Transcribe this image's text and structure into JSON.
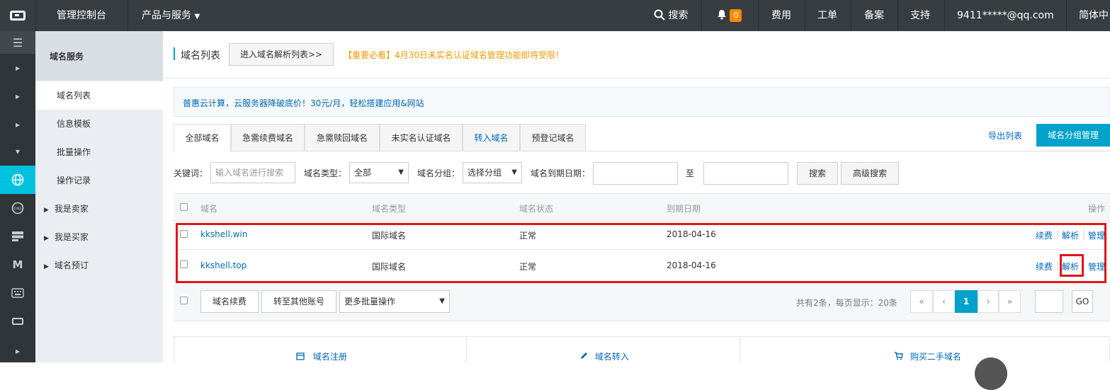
{
  "topbar": {
    "console": "管理控制台",
    "products": "产品与服务",
    "search": "搜索",
    "notifications": "0",
    "fees": "费用",
    "tickets": "工单",
    "icp": "备案",
    "support": "支持",
    "account": "9411*****@qq.com",
    "language": "简体中"
  },
  "sidebar": {
    "title": "域名服务",
    "items": [
      "域名列表",
      "信息模板",
      "批量操作",
      "操作记录",
      "我是卖家",
      "我是买家",
      "域名预订"
    ]
  },
  "header": {
    "title": "域名列表",
    "dns_button": "进入域名解析列表>>",
    "notice": "【重要必看】4月30日未实名认证域名管理功能即将受限！"
  },
  "promo": "普惠云计算，云服务器降破底价！30元/月，轻松搭建应用&网站",
  "tabs": [
    "全部域名",
    "急需续费域名",
    "急需赎回域名",
    "未实名认证域名",
    "转入域名",
    "预登记域名"
  ],
  "actions": {
    "export": "导出列表",
    "group_manage": "域名分组管理"
  },
  "filters": {
    "keyword_label": "关键词：",
    "keyword_placeholder": "输入域名进行搜索",
    "type_label": "域名类型：",
    "type_value": "全部",
    "group_label": "域名分组：",
    "group_value": "选择分组",
    "expire_label": "域名到期日期：",
    "to": "至",
    "search": "搜索",
    "advanced": "高级搜索"
  },
  "table": {
    "headers": [
      "域名",
      "域名类型",
      "域名状态",
      "到期日期",
      "操作"
    ],
    "rows": [
      {
        "domain": "kkshell.win",
        "type": "国际域名",
        "status": "正常",
        "expire": "2018-04-16"
      },
      {
        "domain": "kkshell.top",
        "type": "国际域名",
        "status": "正常",
        "expire": "2018-04-16"
      }
    ],
    "ops": {
      "renew": "续费",
      "dns": "解析",
      "manage": "管理"
    }
  },
  "bottom": {
    "renew": "域名续费",
    "transfer": "转至其他账号",
    "more": "更多批量操作",
    "summary": "共有2条，每页显示：20条",
    "pager": [
      "«",
      "‹",
      "1",
      "›",
      "»"
    ],
    "go": "GO"
  },
  "services": [
    "域名注册",
    "域名转入",
    "购买二手域名"
  ],
  "colors": {
    "highlight": "#e0151b",
    "accent": "#00a2ca",
    "link": "#0068b7",
    "notice": "#f39800"
  }
}
